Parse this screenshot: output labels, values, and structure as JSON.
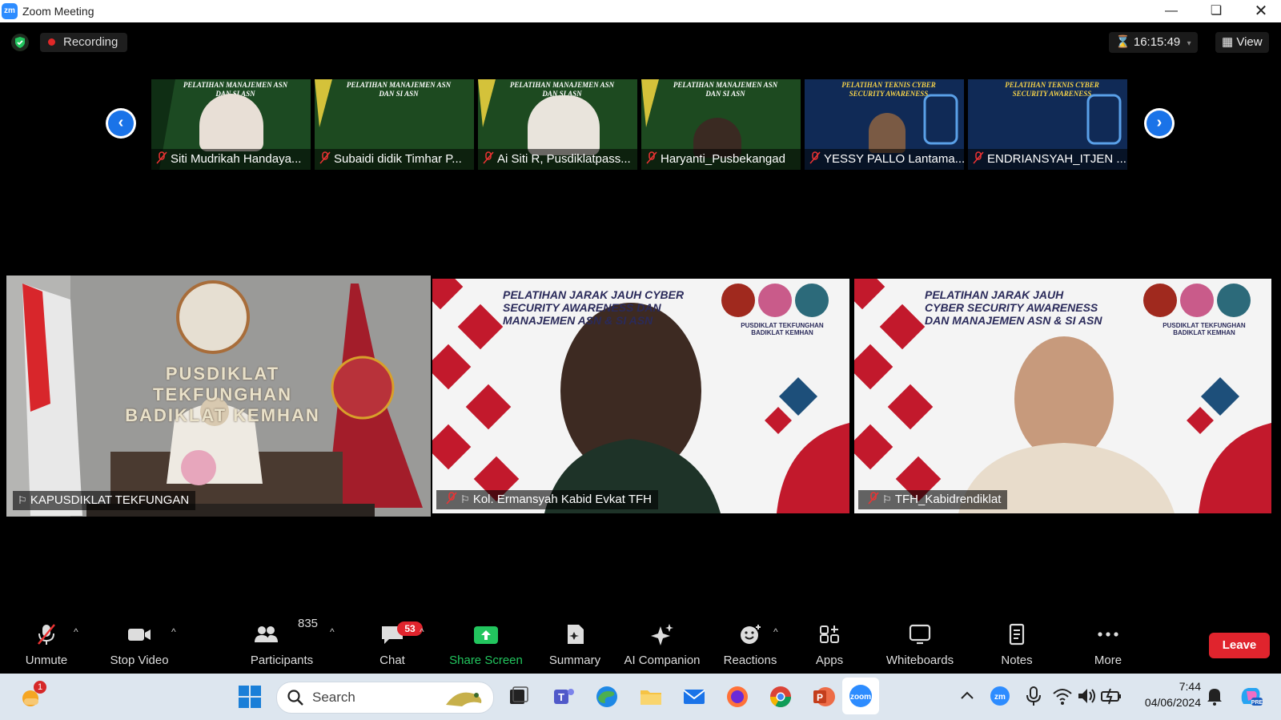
{
  "window": {
    "title": "Zoom Meeting",
    "app_icon_text": "zm"
  },
  "meeting": {
    "recording_label": "Recording",
    "timer": "16:15:49",
    "view_label": "View"
  },
  "thumbnails": [
    {
      "name": "Siti Mudrikah Handaya...",
      "banner": "PELATIHAN MANAJEMEN ASN DAN SI ASN"
    },
    {
      "name": "Subaidi didik Timhar P...",
      "banner": "PELATIHAN MANAJEMEN ASN DAN SI ASN"
    },
    {
      "name": "Ai Siti R, Pusdiklatpass...",
      "banner": "PELATIHAN MANAJEMEN ASN DAN SI ASN"
    },
    {
      "name": "Haryanti_Pusbekangad",
      "banner": "PELATIHAN MANAJEMEN ASN DAN SI ASN"
    },
    {
      "name": "YESSY PALLO Lantama...",
      "banner": "PELATIHAN TEKNIS CYBER SECURITY AWARENESS"
    },
    {
      "name": "ENDRIANSYAH_ITJEN ...",
      "banner": "PELATIHAN TEKNIS CYBER SECURITY AWARENESS"
    }
  ],
  "tiles": [
    {
      "name": "KAPUSDIKLAT TEKFUNGAN",
      "wall_text_1": "PUSDIKLAT TEKFUNGHAN",
      "wall_text_2": "BADIKLAT KEMHAN"
    },
    {
      "name": "Kol. Ermansyah Kabid Evkat TFH",
      "banner": "PELATIHAN JARAK JAUH CYBER SECURITY AWARENESS DAN MANAJEMEN ASN & SI ASN",
      "org": "PUSDIKLAT TEKFUNGHAN BADIKLAT KEMHAN"
    },
    {
      "name": "TFH_Kabidrendiklat",
      "banner_1": "PELATIHAN JARAK JAUH",
      "banner_2": "CYBER SECURITY AWARENESS",
      "banner_3": "DAN MANAJEMEN ASN & SI ASN",
      "org": "PUSDIKLAT TEKFUNGHAN BADIKLAT KEMHAN"
    }
  ],
  "toolbar": {
    "unmute": "Unmute",
    "stop_video": "Stop Video",
    "participants": "Participants",
    "participants_count": "835",
    "chat": "Chat",
    "chat_badge": "53",
    "share_screen": "Share Screen",
    "summary": "Summary",
    "ai_companion": "AI Companion",
    "reactions": "Reactions",
    "apps": "Apps",
    "whiteboards": "Whiteboards",
    "notes": "Notes",
    "more": "More",
    "leave": "Leave"
  },
  "taskbar": {
    "search_placeholder": "Search",
    "time": "7:44",
    "date": "04/06/2024",
    "weather_badge": "1"
  },
  "colors": {
    "accent_blue": "#1a73e8",
    "leave_red": "#e0242d",
    "share_green": "#22c55e",
    "active_speaker": "#d9e64a"
  }
}
